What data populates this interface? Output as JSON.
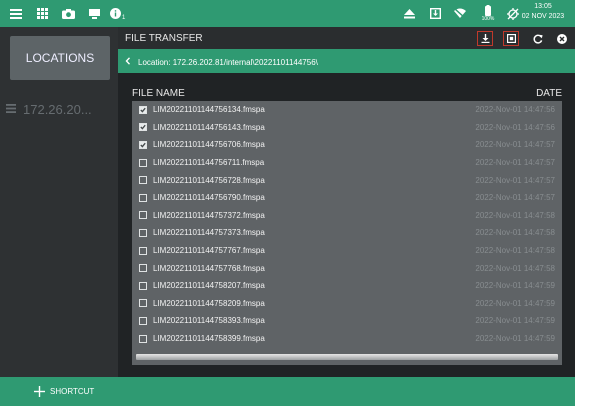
{
  "status_bar": {
    "icons": [
      "menu-icon",
      "grid-icon",
      "camera-icon",
      "screen-icon",
      "info-icon",
      "eject-icon",
      "download-box-icon",
      "wifi-off-icon",
      "battery-icon",
      "gps-icon"
    ],
    "info_count": "1",
    "battery_label": "100%",
    "time": "13:05",
    "date": "02 NOV 2023"
  },
  "sidebar": {
    "locations_label": "LOCATIONS",
    "items": [
      {
        "label": "172.26.20..."
      }
    ]
  },
  "panel": {
    "title": "FILE TRANSFER",
    "location_text": "Location: 172.26.202.81/internal\\20221101144756\\",
    "column_file": "FILE NAME",
    "column_date": "DATE",
    "files": [
      {
        "name": "LIM20221101144756134.fmspa",
        "date": "2022-Nov-01 14:47:56",
        "checked": true
      },
      {
        "name": "LIM20221101144756143.fmspa",
        "date": "2022-Nov-01 14:47:56",
        "checked": true
      },
      {
        "name": "LIM20221101144756706.fmspa",
        "date": "2022-Nov-01 14:47:57",
        "checked": true
      },
      {
        "name": "LIM20221101144756711.fmspa",
        "date": "2022-Nov-01 14:47:57",
        "checked": false
      },
      {
        "name": "LIM20221101144756728.fmspa",
        "date": "2022-Nov-01 14:47:57",
        "checked": false
      },
      {
        "name": "LIM20221101144756790.fmspa",
        "date": "2022-Nov-01 14:47:57",
        "checked": false
      },
      {
        "name": "LIM20221101144757372.fmspa",
        "date": "2022-Nov-01 14:47:58",
        "checked": false
      },
      {
        "name": "LIM20221101144757373.fmspa",
        "date": "2022-Nov-01 14:47:58",
        "checked": false
      },
      {
        "name": "LIM20221101144757767.fmspa",
        "date": "2022-Nov-01 14:47:58",
        "checked": false
      },
      {
        "name": "LIM20221101144757768.fmspa",
        "date": "2022-Nov-01 14:47:58",
        "checked": false
      },
      {
        "name": "LIM20221101144758207.fmspa",
        "date": "2022-Nov-01 14:47:59",
        "checked": false
      },
      {
        "name": "LIM20221101144758209.fmspa",
        "date": "2022-Nov-01 14:47:59",
        "checked": false
      },
      {
        "name": "LIM20221101144758393.fmspa",
        "date": "2022-Nov-01 14:47:59",
        "checked": false
      },
      {
        "name": "LIM20221101144758399.fmspa",
        "date": "2022-Nov-01 14:47:59",
        "checked": false
      }
    ]
  },
  "bottom_bar": {
    "shortcut_label": "SHORTCUT"
  },
  "colors": {
    "accent": "#2f9a72",
    "highlight_border": "#c0392b"
  }
}
